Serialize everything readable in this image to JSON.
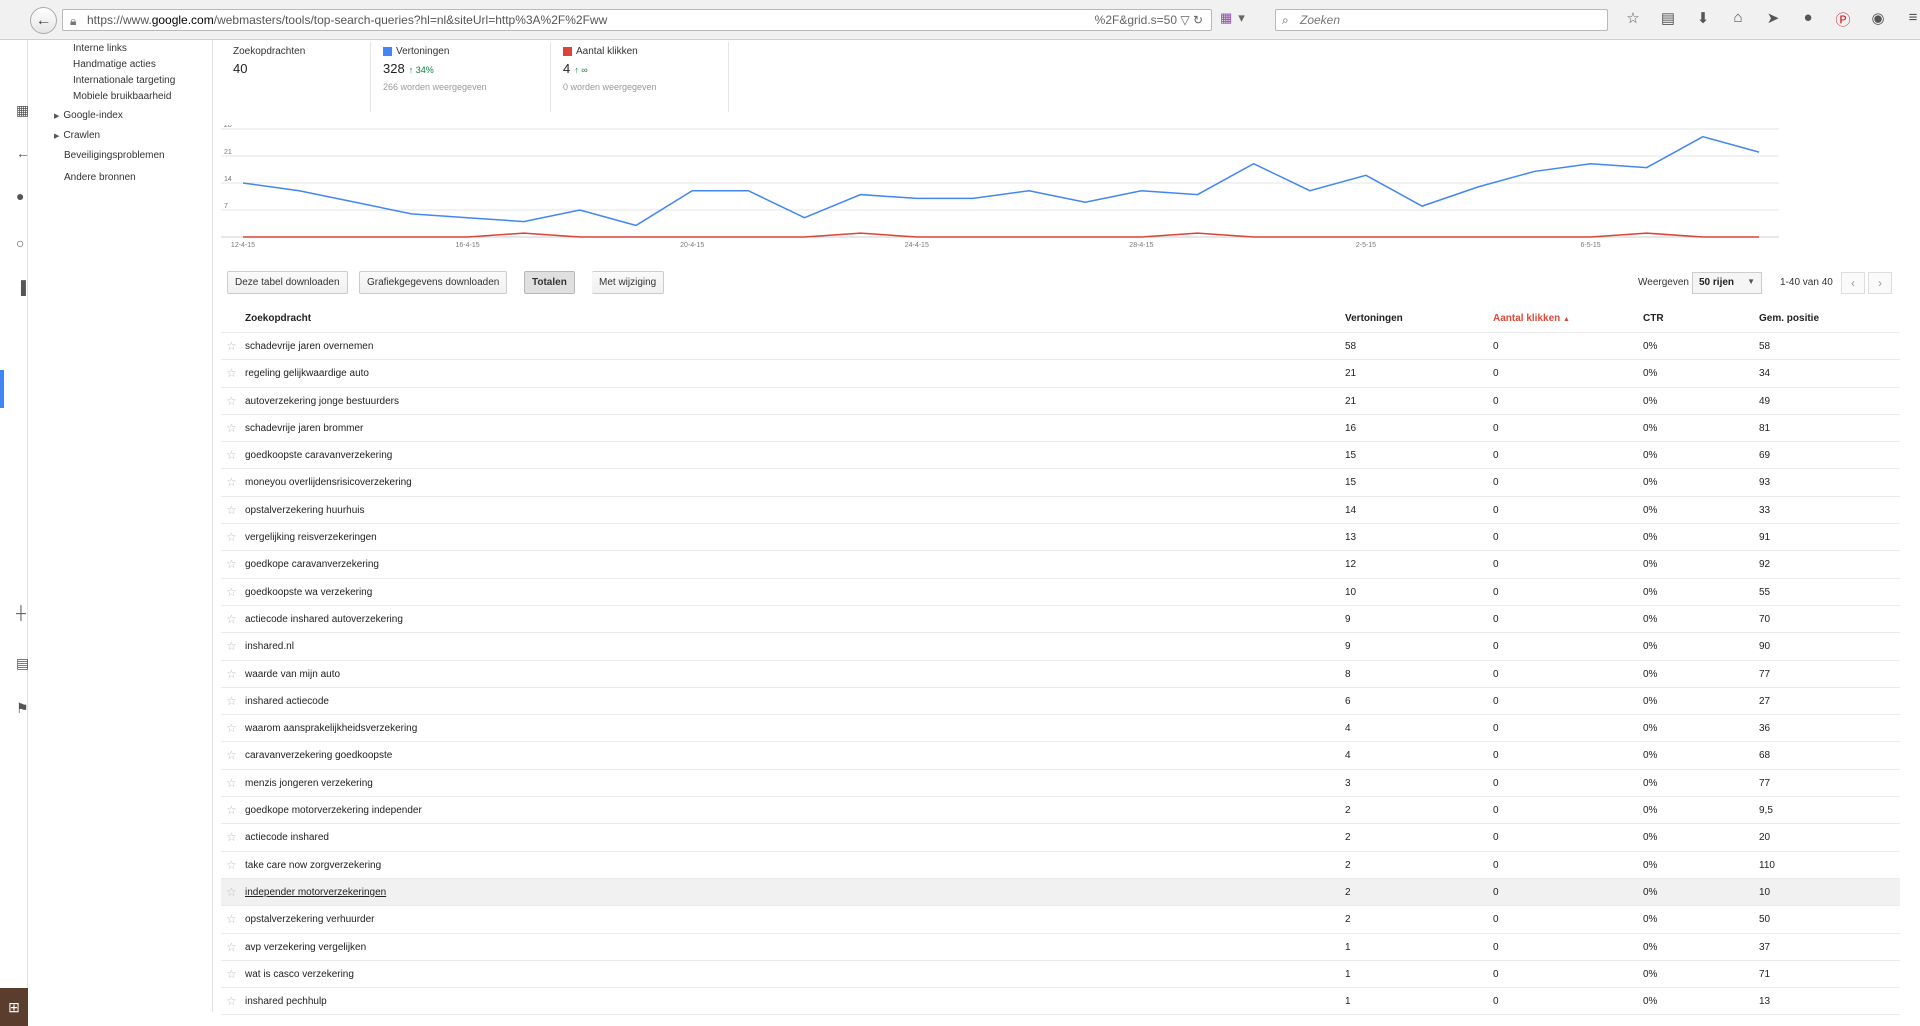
{
  "browser": {
    "url_prefix": "https://www.",
    "url_host": "google.com",
    "url_path": "/webmasters/tools/top-search-queries?hl=nl&siteUrl=http%3A%2F%2Fww",
    "url_tail": "%2F&grid.s=50",
    "search_placeholder": "Zoeken"
  },
  "nav": {
    "items": [
      {
        "label": "Interne links",
        "indent": true
      },
      {
        "label": "Handmatige acties",
        "indent": true
      },
      {
        "label": "Internationale targeting",
        "indent": true
      },
      {
        "label": "Mobiele bruikbaarheid",
        "indent": true
      },
      {
        "label": "Google-index",
        "arrow": true
      },
      {
        "label": "Crawlen",
        "arrow": true
      },
      {
        "label": "Beveiligingsproblemen"
      },
      {
        "label": "Andere bronnen"
      }
    ]
  },
  "stats": {
    "queries": {
      "label": "Zoekopdrachten",
      "value": "40"
    },
    "impressions": {
      "label": "Vertoningen",
      "value": "328",
      "change": "34%",
      "sub": "266 worden weergegeven",
      "color": "#4285f4"
    },
    "clicks": {
      "label": "Aantal klikken",
      "value": "4",
      "change": "∞",
      "sub": "0 worden weergegeven",
      "color": "#db4437"
    }
  },
  "chart_data": {
    "type": "line",
    "x": [
      "12-4-15",
      "13-4-15",
      "14-4-15",
      "15-4-15",
      "16-4-15",
      "17-4-15",
      "18-4-15",
      "19-4-15",
      "20-4-15",
      "21-4-15",
      "22-4-15",
      "23-4-15",
      "24-4-15",
      "25-4-15",
      "26-4-15",
      "27-4-15",
      "28-4-15",
      "29-4-15",
      "30-4-15",
      "1-5-15",
      "2-5-15",
      "3-5-15",
      "4-5-15",
      "5-5-15",
      "6-5-15",
      "7-5-15",
      "8-5-15",
      "9-5-15"
    ],
    "tick_labels": [
      "12-4-15",
      "16-4-15",
      "20-4-15",
      "24-4-15",
      "28-4-15",
      "2-5-15",
      "6-5-15"
    ],
    "y_ticks": [
      7,
      14,
      21,
      28
    ],
    "ylim": [
      0,
      28
    ],
    "series": [
      {
        "values": [
          14,
          12,
          9,
          6,
          5,
          4,
          7,
          3,
          12,
          12,
          5,
          11,
          10,
          10,
          12,
          9,
          12,
          11,
          19,
          12,
          16,
          8,
          13,
          17,
          19,
          18,
          26,
          22
        ],
        "color": "#4285f4"
      },
      {
        "values": [
          0,
          0,
          0,
          0,
          0,
          1,
          0,
          0,
          0,
          0,
          0,
          1,
          0,
          0,
          0,
          0,
          0,
          1,
          0,
          0,
          0,
          0,
          0,
          0,
          0,
          1,
          0,
          0
        ],
        "color": "#db4437"
      }
    ]
  },
  "controls": {
    "download_table": "Deze tabel downloaden",
    "download_chart": "Grafiekgegevens downloaden",
    "totals": "Totalen",
    "with_change": "Met wijziging",
    "show_label": "Weergeven",
    "rows_value": "50 rijen",
    "range": "1-40 van 40"
  },
  "table": {
    "headers": {
      "query": "Zoekopdracht",
      "impressions": "Vertoningen",
      "clicks": "Aantal klikken",
      "sort_arrow": "▲",
      "ctr": "CTR",
      "position": "Gem. positie"
    },
    "rows": [
      {
        "q": "schadevrije jaren overnemen",
        "imp": "58",
        "clk": "0",
        "ctr": "0%",
        "pos": "58"
      },
      {
        "q": "regeling gelijkwaardige auto",
        "imp": "21",
        "clk": "0",
        "ctr": "0%",
        "pos": "34"
      },
      {
        "q": "autoverzekering jonge bestuurders",
        "imp": "21",
        "clk": "0",
        "ctr": "0%",
        "pos": "49"
      },
      {
        "q": "schadevrije jaren brommer",
        "imp": "16",
        "clk": "0",
        "ctr": "0%",
        "pos": "81"
      },
      {
        "q": "goedkoopste caravanverzekering",
        "imp": "15",
        "clk": "0",
        "ctr": "0%",
        "pos": "69"
      },
      {
        "q": "moneyou overlijdensrisicoverzekering",
        "imp": "15",
        "clk": "0",
        "ctr": "0%",
        "pos": "93"
      },
      {
        "q": "opstalverzekering huurhuis",
        "imp": "14",
        "clk": "0",
        "ctr": "0%",
        "pos": "33"
      },
      {
        "q": "vergelijking reisverzekeringen",
        "imp": "13",
        "clk": "0",
        "ctr": "0%",
        "pos": "91"
      },
      {
        "q": "goedkope caravanverzekering",
        "imp": "12",
        "clk": "0",
        "ctr": "0%",
        "pos": "92"
      },
      {
        "q": "goedkoopste wa verzekering",
        "imp": "10",
        "clk": "0",
        "ctr": "0%",
        "pos": "55"
      },
      {
        "q": "actiecode inshared autoverzekering",
        "imp": "9",
        "clk": "0",
        "ctr": "0%",
        "pos": "70"
      },
      {
        "q": "inshared.nl",
        "imp": "9",
        "clk": "0",
        "ctr": "0%",
        "pos": "90"
      },
      {
        "q": "waarde van mijn auto",
        "imp": "8",
        "clk": "0",
        "ctr": "0%",
        "pos": "77"
      },
      {
        "q": "inshared actiecode",
        "imp": "6",
        "clk": "0",
        "ctr": "0%",
        "pos": "27"
      },
      {
        "q": "waarom aansprakelijkheidsverzekering",
        "imp": "4",
        "clk": "0",
        "ctr": "0%",
        "pos": "36"
      },
      {
        "q": "caravanverzekering goedkoopste",
        "imp": "4",
        "clk": "0",
        "ctr": "0%",
        "pos": "68"
      },
      {
        "q": "menzis jongeren verzekering",
        "imp": "3",
        "clk": "0",
        "ctr": "0%",
        "pos": "77"
      },
      {
        "q": "goedkope motorverzekering independer",
        "imp": "2",
        "clk": "0",
        "ctr": "0%",
        "pos": "9,5"
      },
      {
        "q": "actiecode inshared",
        "imp": "2",
        "clk": "0",
        "ctr": "0%",
        "pos": "20"
      },
      {
        "q": "take care now zorgverzekering",
        "imp": "2",
        "clk": "0",
        "ctr": "0%",
        "pos": "110"
      },
      {
        "q": "independer motorverzekeringen",
        "imp": "2",
        "clk": "0",
        "ctr": "0%",
        "pos": "10",
        "hover": true
      },
      {
        "q": "opstalverzekering verhuurder",
        "imp": "2",
        "clk": "0",
        "ctr": "0%",
        "pos": "50"
      },
      {
        "q": "avp verzekering vergelijken",
        "imp": "1",
        "clk": "0",
        "ctr": "0%",
        "pos": "37"
      },
      {
        "q": "wat is casco verzekering",
        "imp": "1",
        "clk": "0",
        "ctr": "0%",
        "pos": "71"
      },
      {
        "q": "inshared pechhulp",
        "imp": "1",
        "clk": "0",
        "ctr": "0%",
        "pos": "13"
      }
    ]
  }
}
